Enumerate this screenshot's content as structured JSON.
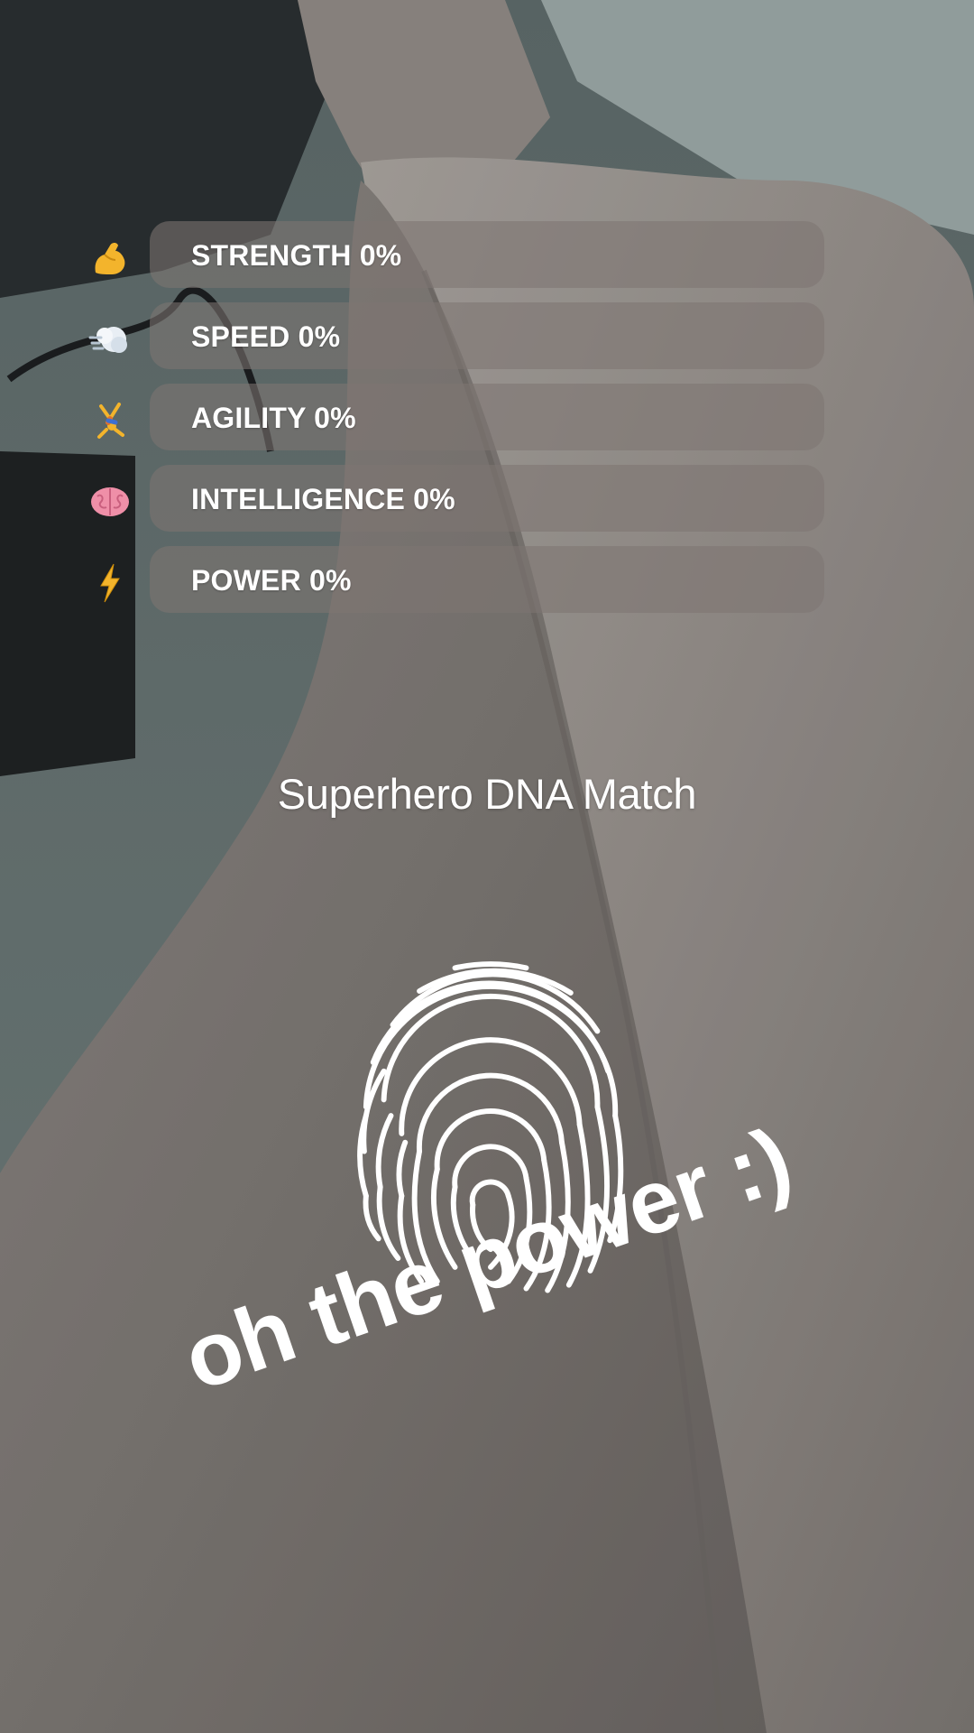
{
  "filter": {
    "title": "Superhero DNA Match",
    "stats": [
      {
        "icon": "flexed-biceps-icon",
        "label": "STRENGTH 0%",
        "value": 0
      },
      {
        "icon": "dash-cloud-icon",
        "label": "SPEED 0%",
        "value": 0
      },
      {
        "icon": "cartwheel-person-icon",
        "label": "AGILITY 0%",
        "value": 0
      },
      {
        "icon": "brain-icon",
        "label": "INTELLIGENCE 0%",
        "value": 0
      },
      {
        "icon": "lightning-bolt-icon",
        "label": "POWER 0%",
        "value": 0
      }
    ]
  },
  "caption": {
    "text": "oh the power :)"
  },
  "colors": {
    "text": "#ffffff",
    "bar_track": "#7d7672",
    "accent_gold": "#f3b42c",
    "brain_pink": "#ef8fa8"
  }
}
